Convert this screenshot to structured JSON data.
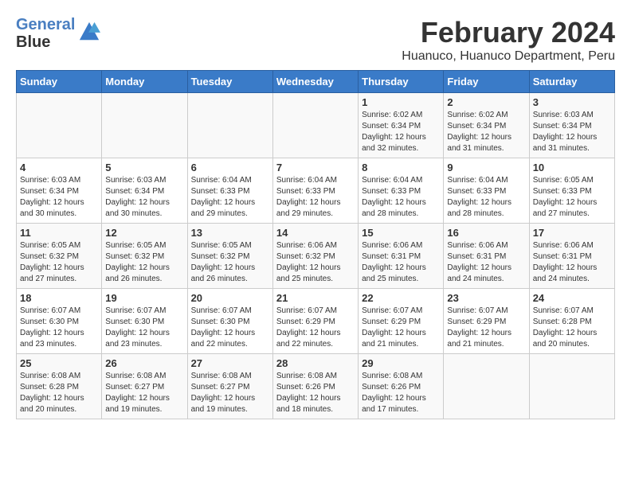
{
  "header": {
    "logo_line1": "General",
    "logo_line2": "Blue",
    "month_year": "February 2024",
    "location": "Huanuco, Huanuco Department, Peru"
  },
  "weekdays": [
    "Sunday",
    "Monday",
    "Tuesday",
    "Wednesday",
    "Thursday",
    "Friday",
    "Saturday"
  ],
  "weeks": [
    [
      {
        "day": "",
        "info": ""
      },
      {
        "day": "",
        "info": ""
      },
      {
        "day": "",
        "info": ""
      },
      {
        "day": "",
        "info": ""
      },
      {
        "day": "1",
        "info": "Sunrise: 6:02 AM\nSunset: 6:34 PM\nDaylight: 12 hours\nand 32 minutes."
      },
      {
        "day": "2",
        "info": "Sunrise: 6:02 AM\nSunset: 6:34 PM\nDaylight: 12 hours\nand 31 minutes."
      },
      {
        "day": "3",
        "info": "Sunrise: 6:03 AM\nSunset: 6:34 PM\nDaylight: 12 hours\nand 31 minutes."
      }
    ],
    [
      {
        "day": "4",
        "info": "Sunrise: 6:03 AM\nSunset: 6:34 PM\nDaylight: 12 hours\nand 30 minutes."
      },
      {
        "day": "5",
        "info": "Sunrise: 6:03 AM\nSunset: 6:34 PM\nDaylight: 12 hours\nand 30 minutes."
      },
      {
        "day": "6",
        "info": "Sunrise: 6:04 AM\nSunset: 6:33 PM\nDaylight: 12 hours\nand 29 minutes."
      },
      {
        "day": "7",
        "info": "Sunrise: 6:04 AM\nSunset: 6:33 PM\nDaylight: 12 hours\nand 29 minutes."
      },
      {
        "day": "8",
        "info": "Sunrise: 6:04 AM\nSunset: 6:33 PM\nDaylight: 12 hours\nand 28 minutes."
      },
      {
        "day": "9",
        "info": "Sunrise: 6:04 AM\nSunset: 6:33 PM\nDaylight: 12 hours\nand 28 minutes."
      },
      {
        "day": "10",
        "info": "Sunrise: 6:05 AM\nSunset: 6:33 PM\nDaylight: 12 hours\nand 27 minutes."
      }
    ],
    [
      {
        "day": "11",
        "info": "Sunrise: 6:05 AM\nSunset: 6:32 PM\nDaylight: 12 hours\nand 27 minutes."
      },
      {
        "day": "12",
        "info": "Sunrise: 6:05 AM\nSunset: 6:32 PM\nDaylight: 12 hours\nand 26 minutes."
      },
      {
        "day": "13",
        "info": "Sunrise: 6:05 AM\nSunset: 6:32 PM\nDaylight: 12 hours\nand 26 minutes."
      },
      {
        "day": "14",
        "info": "Sunrise: 6:06 AM\nSunset: 6:32 PM\nDaylight: 12 hours\nand 25 minutes."
      },
      {
        "day": "15",
        "info": "Sunrise: 6:06 AM\nSunset: 6:31 PM\nDaylight: 12 hours\nand 25 minutes."
      },
      {
        "day": "16",
        "info": "Sunrise: 6:06 AM\nSunset: 6:31 PM\nDaylight: 12 hours\nand 24 minutes."
      },
      {
        "day": "17",
        "info": "Sunrise: 6:06 AM\nSunset: 6:31 PM\nDaylight: 12 hours\nand 24 minutes."
      }
    ],
    [
      {
        "day": "18",
        "info": "Sunrise: 6:07 AM\nSunset: 6:30 PM\nDaylight: 12 hours\nand 23 minutes."
      },
      {
        "day": "19",
        "info": "Sunrise: 6:07 AM\nSunset: 6:30 PM\nDaylight: 12 hours\nand 23 minutes."
      },
      {
        "day": "20",
        "info": "Sunrise: 6:07 AM\nSunset: 6:30 PM\nDaylight: 12 hours\nand 22 minutes."
      },
      {
        "day": "21",
        "info": "Sunrise: 6:07 AM\nSunset: 6:29 PM\nDaylight: 12 hours\nand 22 minutes."
      },
      {
        "day": "22",
        "info": "Sunrise: 6:07 AM\nSunset: 6:29 PM\nDaylight: 12 hours\nand 21 minutes."
      },
      {
        "day": "23",
        "info": "Sunrise: 6:07 AM\nSunset: 6:29 PM\nDaylight: 12 hours\nand 21 minutes."
      },
      {
        "day": "24",
        "info": "Sunrise: 6:07 AM\nSunset: 6:28 PM\nDaylight: 12 hours\nand 20 minutes."
      }
    ],
    [
      {
        "day": "25",
        "info": "Sunrise: 6:08 AM\nSunset: 6:28 PM\nDaylight: 12 hours\nand 20 minutes."
      },
      {
        "day": "26",
        "info": "Sunrise: 6:08 AM\nSunset: 6:27 PM\nDaylight: 12 hours\nand 19 minutes."
      },
      {
        "day": "27",
        "info": "Sunrise: 6:08 AM\nSunset: 6:27 PM\nDaylight: 12 hours\nand 19 minutes."
      },
      {
        "day": "28",
        "info": "Sunrise: 6:08 AM\nSunset: 6:26 PM\nDaylight: 12 hours\nand 18 minutes."
      },
      {
        "day": "29",
        "info": "Sunrise: 6:08 AM\nSunset: 6:26 PM\nDaylight: 12 hours\nand 17 minutes."
      },
      {
        "day": "",
        "info": ""
      },
      {
        "day": "",
        "info": ""
      }
    ]
  ]
}
